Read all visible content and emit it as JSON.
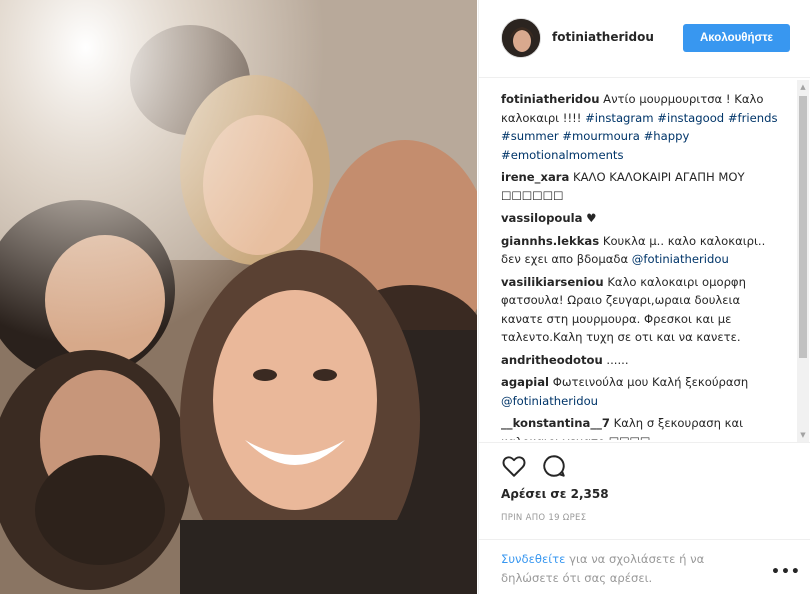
{
  "post": {
    "username": "fotiniatheridou",
    "follow_label": "Ακολουθήστε"
  },
  "comments": [
    {
      "user": "fotiniatheridou",
      "text_plain": " Αντίο μουρμουριτσα ! Καλο καλοκαιρι !!!! ",
      "tags": [
        "#instagram",
        "#instagood",
        "#friends",
        "#summer",
        "#mourmoura",
        "#happy",
        "#emotionalmoments"
      ]
    },
    {
      "user": "irene_xara",
      "text": " ΚΑΛΟ ΚΑΛΟΚΑΙΡΙ ΑΓΑΠΗ ΜΟΥ ☐☐☐☐☐☐"
    },
    {
      "user": "vassilopoula",
      "text": " ♥"
    },
    {
      "user": "giannhs.lekkas",
      "text": " Κουκλα μ.. καλο καλοκαιρι.. δεν εχει απο βδομαδα ",
      "mention": "@fotiniatheridou"
    },
    {
      "user": "vasilikiarseniou",
      "text": " Καλο καλοκαιρι ομορφη φατσουλα! Ωραιο ζευγαρι,ωραια δουλεια κανατε στη μουρμουρα. Φρεσκοι και με ταλεντο.Καλη τυχη σε οτι και να κανετε."
    },
    {
      "user": "andritheodotou",
      "text": " ......"
    },
    {
      "user": "agapial",
      "text": " Φωτεινούλα μου Καλή ξεκούραση ",
      "mention": "@fotiniatheridou"
    },
    {
      "user": "__konstantina__7",
      "text": " Καλη σ ξεκουραση και καλοκαιρι γεματο ☐☐☐☐"
    }
  ],
  "actions": {
    "likes": "Αρέσει σε 2,358",
    "time": "ΠΡΙΝ ΑΠΟ 19 ΩΡΕΣ",
    "login_link": "Συνδεθείτε",
    "login_text": " για να σχολιάσετε ή να δηλώσετε ότι σας αρέσει.",
    "more": "•••"
  },
  "icons": {
    "like": "heart-outline-icon",
    "comment": "speech-bubble-icon",
    "more": "more-options-icon"
  },
  "colors": {
    "accent": "#3897f0",
    "hashtag": "#003569",
    "muted": "#999999"
  }
}
